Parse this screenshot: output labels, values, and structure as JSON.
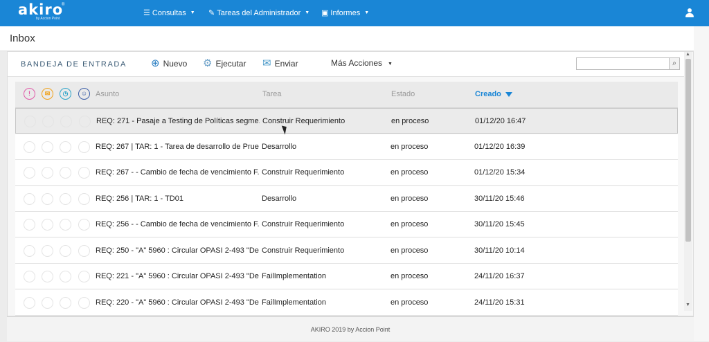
{
  "app": {
    "logo": "akiro",
    "logo_sub": "by Accion Point",
    "logo_dot": "®"
  },
  "nav": [
    {
      "icon": "list-icon",
      "label": "Consultas"
    },
    {
      "icon": "wrench-icon",
      "label": "Tareas del Administrador"
    },
    {
      "icon": "briefcase-icon",
      "label": "Informes"
    }
  ],
  "page": {
    "title": "Inbox"
  },
  "toolbar": {
    "title": "BANDEJA DE ENTRADA",
    "new_label": "Nuevo",
    "run_label": "Ejecutar",
    "send_label": "Enviar",
    "more_label": "Más Acciones",
    "search_placeholder": ""
  },
  "table": {
    "headers": {
      "subject": "Asunto",
      "task": "Tarea",
      "status": "Estado",
      "created": "Creado"
    },
    "header_icons": [
      {
        "name": "priority-icon",
        "glyph": "!",
        "color": "#e05aa8"
      },
      {
        "name": "mail-icon",
        "glyph": "✉",
        "color": "#f0a21b"
      },
      {
        "name": "clock-icon",
        "glyph": "◷",
        "color": "#2aa3c9"
      },
      {
        "name": "group-icon",
        "glyph": "☺",
        "color": "#3b5ea8"
      }
    ],
    "rows": [
      {
        "subject": "REQ: 271 - Pasaje a Testing de Políticas segme...",
        "task": "Construir Requerimiento",
        "status": "en proceso",
        "created": "01/12/20 16:47"
      },
      {
        "subject": "REQ: 267 | TAR: 1 - Tarea de desarrollo de Prue...",
        "task": "Desarrollo",
        "status": "en proceso",
        "created": "01/12/20 16:39"
      },
      {
        "subject": "REQ: 267 - - Cambio de fecha de vencimiento F...",
        "task": "Construir Requerimiento",
        "status": "en proceso",
        "created": "01/12/20 15:34"
      },
      {
        "subject": "REQ: 256 | TAR: 1 - TD01",
        "task": "Desarrollo",
        "status": "en proceso",
        "created": "30/11/20 15:46"
      },
      {
        "subject": "REQ: 256 - - Cambio de fecha de vencimiento F...",
        "task": "Construir Requerimiento",
        "status": "en proceso",
        "created": "30/11/20 15:45"
      },
      {
        "subject": "REQ: 250 - \"A\" 5960 : Circular OPASI 2-493 \"De",
        "task": "Construir Requerimiento",
        "status": "en proceso",
        "created": "30/11/20 10:14"
      },
      {
        "subject": "REQ: 221 - \"A\" 5960 : Circular OPASI 2-493 \"De",
        "task": "FailImplementation",
        "status": "en proceso",
        "created": "24/11/20 16:37"
      },
      {
        "subject": "REQ: 220 - \"A\" 5960 : Circular OPASI 2-493 \"De",
        "task": "FailImplementation",
        "status": "en proceso",
        "created": "24/11/20 15:31"
      }
    ]
  },
  "footer": {
    "text": "AKIRO 2019 by Accion Point"
  }
}
